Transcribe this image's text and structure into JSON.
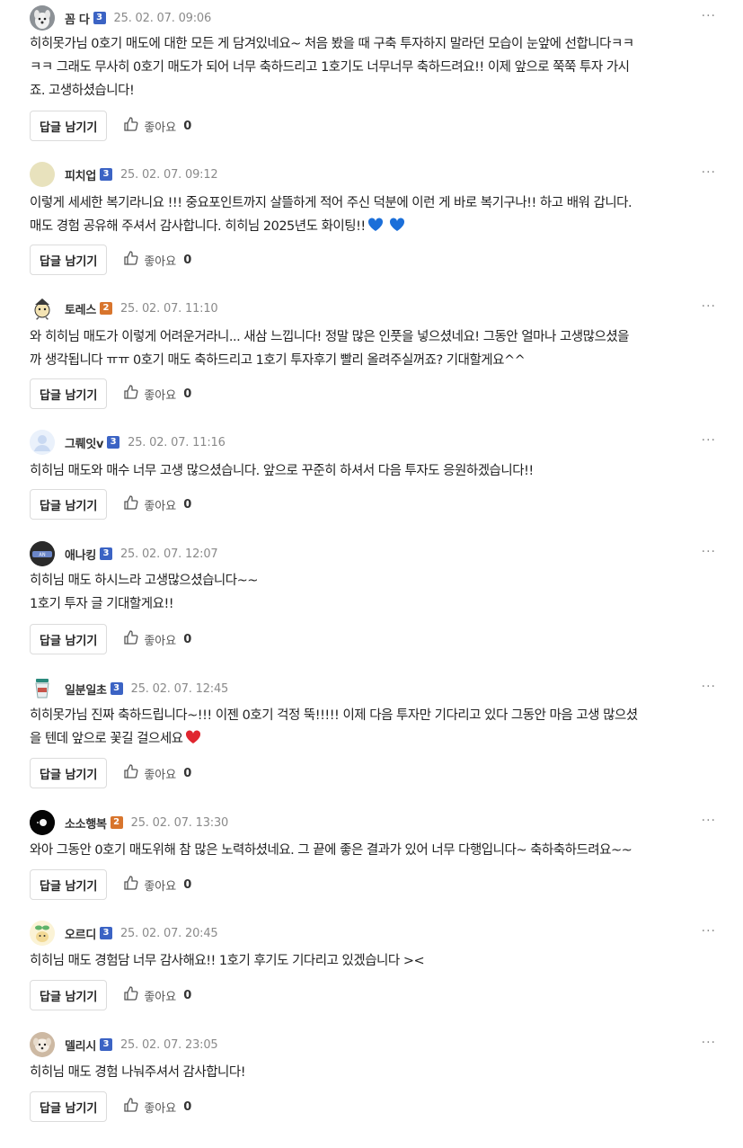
{
  "labels": {
    "reply": "답글 남기기",
    "like": "좋아요",
    "more": "···"
  },
  "colors": {
    "level3": "#3b63c4",
    "level2": "#d8752d",
    "blue_heart": "#1b6fd9",
    "red_heart": "#e0262f"
  },
  "comments": [
    {
      "author": "꼼 다",
      "level": "3",
      "date": "25. 02. 07. 09:06",
      "text": "히히못가님 0호기 매도에 대한 모든 게 담겨있네요~ 처음 봤을 때 구축 투자하지 말라던 모습이 눈앞에 선합니다ㅋㅋ\nㅋㅋ 그래도 무사히 0호기 매도가 되어 너무 축하드리고 1호기도 너무너무 축하드려요!! 이제 앞으로 쭉쭉 투자 가시\n죠. 고생하셨습니다!",
      "likes": "0",
      "avatar": "dog-avatar"
    },
    {
      "author": "피치업",
      "level": "3",
      "date": "25. 02. 07. 09:12",
      "text": "이렇게 세세한 복기라니요 !!!  중요포인트까지 살뜰하게 적어 주신 덕분에 이런 게 바로 복기구나!! 하고 배워 갑니다.\n매도 경험 공유해 주셔서 감사합니다. 히히님 2025년도 화이팅!!",
      "likes": "0",
      "avatar": "beige-circle-avatar",
      "emoji": "blue-hearts"
    },
    {
      "author": "토레스",
      "level": "2",
      "date": "25. 02. 07. 11:10",
      "text": "와 히히님 매도가 이렇게 어려운거라니... 새삼 느낍니다! 정말 많은 인풋을 넣으셨네요! 그동안 얼마나 고생많으셨을\n까 생각됩니다 ㅠㅠ 0호기 매도 축하드리고 1호기 투자후기 빨리 올려주실꺼죠? 기대할게요^^",
      "likes": "0",
      "avatar": "character-avatar"
    },
    {
      "author": "그뤠잇v",
      "level": "3",
      "date": "25. 02. 07. 11:16",
      "text": "히히님 매도와 매수 너무 고생 많으셨습니다. 앞으로 꾸준히 하셔서 다음 투자도 응원하겠습니다!!",
      "likes": "0",
      "avatar": "default-user-avatar"
    },
    {
      "author": "애나킹",
      "level": "3",
      "date": "25. 02. 07. 12:07",
      "text": "히히님 매도 하시느라 고생많으셨습니다~~\n1호기 투자 글 기대할게요!!",
      "likes": "0",
      "avatar": "dark-logo-avatar"
    },
    {
      "author": "일분일초",
      "level": "3",
      "date": "25. 02. 07. 12:45",
      "text": "히히못가님 진짜 축하드립니다~!!! 이젠 0호기 걱정 뚝!!!!! 이제 다음 투자만 기다리고 있다 그동안 마음 고생 많으셨\n을 텐데 앞으로 꽃길 걸으세요",
      "likes": "0",
      "avatar": "cup-avatar",
      "emoji": "red-heart"
    },
    {
      "author": "소소행복",
      "level": "2",
      "date": "25. 02. 07. 13:30",
      "text": "와아 그동안 0호기 매도위해 참 많은 노력하셨네요. 그 끝에 좋은 결과가 있어 너무 다행입니다~ 축하축하드려요~~",
      "likes": "0",
      "avatar": "black-circle-avatar"
    },
    {
      "author": "오르디",
      "level": "3",
      "date": "25. 02. 07. 20:45",
      "text": "히히님 매도 경험담 너무 감사해요!! 1호기 후기도 기다리고 있겠습니다 ><",
      "likes": "0",
      "avatar": "sprout-avatar"
    },
    {
      "author": "델리시",
      "level": "3",
      "date": "25. 02. 07. 23:05",
      "text": "히히님 매도 경험 나눠주셔서 감사합니다!",
      "likes": "0",
      "avatar": "puppy-avatar"
    }
  ]
}
